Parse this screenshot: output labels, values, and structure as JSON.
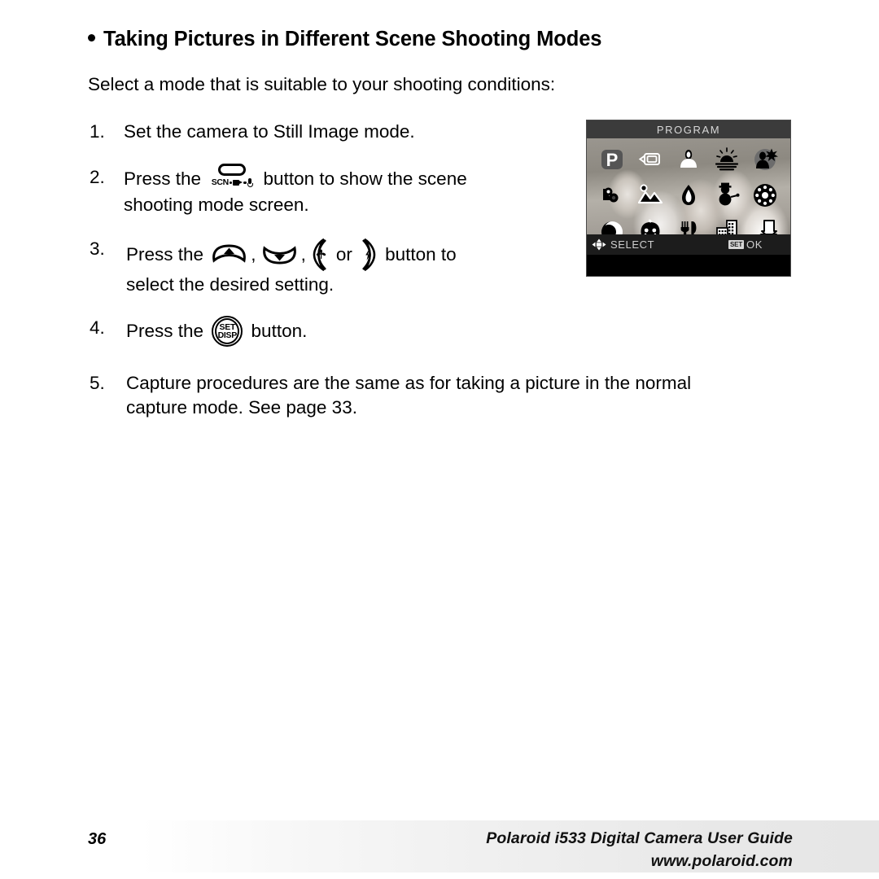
{
  "page": {
    "heading": "Taking Pictures in Different Scene Shooting Modes",
    "intro": "Select a mode that is suitable to your shooting conditions:"
  },
  "steps": [
    {
      "number": "1.",
      "text_before": "Set the camera to Still Image mode.",
      "text_after": "",
      "line2": ""
    },
    {
      "number": "2.",
      "text_before": "Press the ",
      "text_after": " button to show the scene",
      "line2": "shooting mode screen.",
      "button": {
        "label": "SCN",
        "icons": [
          "video-camera-icon",
          "microphone-icon"
        ]
      }
    },
    {
      "number": "3.",
      "text_before": "Press the ",
      "separator1": ",",
      "separator2": ",",
      "or_word": "or",
      "text_after": " button to",
      "line2": "select the desired setting."
    },
    {
      "number": "4.",
      "text_before": "Press the ",
      "text_after": " button.",
      "button": {
        "line1": "SET",
        "line2": "DISP"
      }
    },
    {
      "number": "5.",
      "text_before": "Capture procedures are the same as for taking a picture in the normal",
      "line2": "capture mode. See page 33."
    }
  ],
  "lcd": {
    "title": "PROGRAM",
    "footer": {
      "select_label": "SELECT",
      "set_badge": "SET",
      "ok_label": "OK"
    },
    "scene_modes": [
      {
        "row": 1,
        "name": "program-mode-icon",
        "label": "P"
      },
      {
        "row": 1,
        "name": "video-clip-mode-icon",
        "label": ""
      },
      {
        "row": 1,
        "name": "portrait-mode-icon",
        "label": ""
      },
      {
        "row": 1,
        "name": "sunset-mode-icon",
        "label": ""
      },
      {
        "row": 1,
        "name": "night-portrait-mode-icon",
        "label": ""
      },
      {
        "row": 2,
        "name": "sports-mode-icon",
        "label": ""
      },
      {
        "row": 2,
        "name": "landscape-mode-icon",
        "label": ""
      },
      {
        "row": 2,
        "name": "candlelight-mode-icon",
        "label": ""
      },
      {
        "row": 2,
        "name": "snow-mode-icon",
        "label": ""
      },
      {
        "row": 2,
        "name": "fireworks-mode-icon",
        "label": ""
      },
      {
        "row": 3,
        "name": "night-scene-mode-icon",
        "label": ""
      },
      {
        "row": 3,
        "name": "children-mode-icon",
        "label": ""
      },
      {
        "row": 3,
        "name": "food-mode-icon",
        "label": ""
      },
      {
        "row": 3,
        "name": "building-mode-icon",
        "label": ""
      },
      {
        "row": 3,
        "name": "text-mode-icon",
        "label": ""
      }
    ]
  },
  "footer": {
    "page_number": "36",
    "guide_title": "Polaroid i533 Digital Camera User Guide",
    "website": "www.polaroid.com"
  },
  "colors": {
    "page_background": "#ffffff",
    "text": "#000000",
    "lcd_titlebar": "#3b3b3b",
    "lcd_footer": "#1c1c1c",
    "lcd_label_text": "#cfcfcf",
    "footer_gradient_end": "#e6e6e6"
  }
}
